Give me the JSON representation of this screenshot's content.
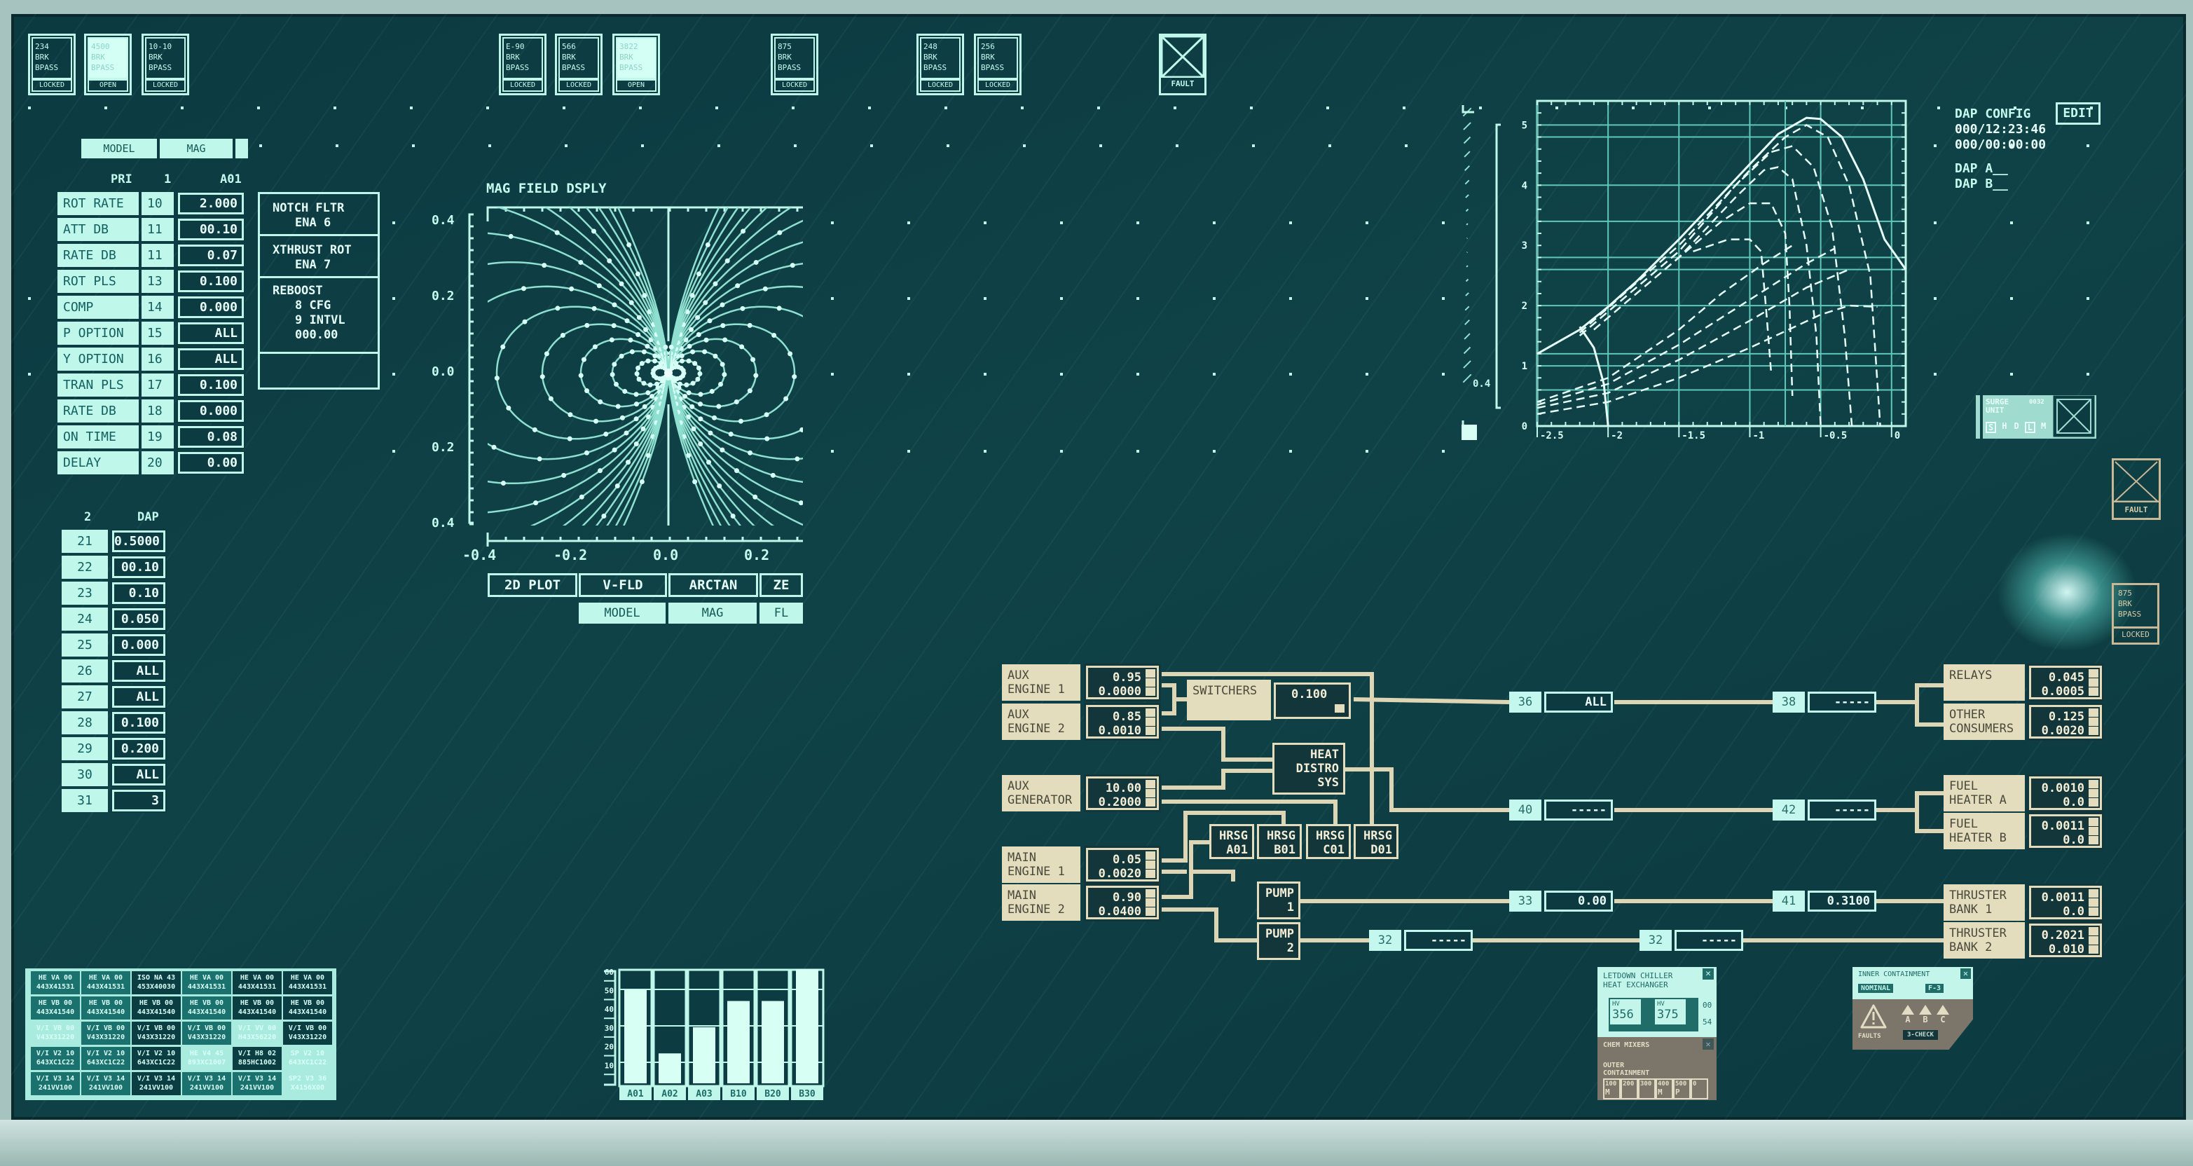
{
  "colors": {
    "screen": "#0c3a41",
    "accent_cyan": "#bff7ea",
    "diagram_tan": "#e3dcbd",
    "frame": "#a7c3bf"
  },
  "top_tiles": [
    {
      "code": "234",
      "l1": "BRK",
      "l2": "BPASS",
      "status": "LOCKED",
      "open": false
    },
    {
      "code": "4500",
      "l1": "BRK",
      "l2": "BPASS",
      "status": "OPEN",
      "open": true
    },
    {
      "code": "10-10",
      "l1": "BRK",
      "l2": "BPASS",
      "status": "LOCKED",
      "open": false
    },
    {
      "code": "E-90",
      "l1": "BRK",
      "l2": "BPASS",
      "status": "LOCKED",
      "open": false
    },
    {
      "code": "566",
      "l1": "BRK",
      "l2": "BPASS",
      "status": "LOCKED",
      "open": false
    },
    {
      "code": "3822",
      "l1": "BRK",
      "l2": "BPASS",
      "status": "OPEN",
      "open": true
    },
    {
      "code": "875",
      "l1": "BRK",
      "l2": "BPASS",
      "status": "LOCKED",
      "open": false
    },
    {
      "code": "248",
      "l1": "BRK",
      "l2": "BPASS",
      "status": "LOCKED",
      "open": false
    },
    {
      "code": "256",
      "l1": "BRK",
      "l2": "BPASS",
      "status": "LOCKED",
      "open": false
    }
  ],
  "top_fault": {
    "label": "FAULT",
    "icon": "x-box-icon"
  },
  "left_tabs": [
    "MODEL",
    "MAG",
    ""
  ],
  "pri_table": {
    "headers": [
      "PRI",
      "1",
      "A01"
    ],
    "rows": [
      {
        "label": "ROT RATE",
        "code": "10",
        "value": "2.000"
      },
      {
        "label": "ATT DB",
        "code": "11",
        "value": "00.10"
      },
      {
        "label": "RATE DB",
        "code": "11",
        "value": "0.07"
      },
      {
        "label": "ROT PLS",
        "code": "13",
        "value": "0.100"
      },
      {
        "label": "COMP",
        "code": "14",
        "value": "0.000"
      },
      {
        "label": "P OPTION",
        "code": "15",
        "value": "ALL"
      },
      {
        "label": "Y OPTION",
        "code": "16",
        "value": "ALL"
      },
      {
        "label": "TRAN PLS",
        "code": "17",
        "value": "0.100"
      },
      {
        "label": "RATE DB",
        "code": "18",
        "value": "0.000"
      },
      {
        "label": "ON TIME",
        "code": "19",
        "value": "0.08"
      },
      {
        "label": "DELAY",
        "code": "20",
        "value": "0.00"
      }
    ]
  },
  "options_panel": {
    "notch": [
      "NOTCH FLTR",
      "ENA 6"
    ],
    "xthrust": [
      "XTHRUST ROT",
      "ENA 7"
    ],
    "reboost": [
      "REBOOST",
      "8 CFG",
      "9 INTVL",
      "000.00"
    ]
  },
  "dap_table": {
    "headers": [
      "2",
      "DAP"
    ],
    "rows": [
      {
        "code": "21",
        "value": "0.5000"
      },
      {
        "code": "22",
        "value": "00.10"
      },
      {
        "code": "23",
        "value": "0.10"
      },
      {
        "code": "24",
        "value": "0.050"
      },
      {
        "code": "25",
        "value": "0.000"
      },
      {
        "code": "26",
        "value": "ALL"
      },
      {
        "code": "27",
        "value": "ALL"
      },
      {
        "code": "28",
        "value": "0.100"
      },
      {
        "code": "29",
        "value": "0.200"
      },
      {
        "code": "30",
        "value": "ALL"
      },
      {
        "code": "31",
        "value": "3"
      }
    ]
  },
  "mag_plot": {
    "title": "MAG FIELD DSPLY",
    "y_ticks": [
      "0.4",
      "0.2",
      "0.0",
      "0.2",
      "0.4"
    ],
    "x_ticks": [
      "-0.4",
      "-0.2",
      "0.0",
      "0.2"
    ],
    "mode_buttons": [
      "2D PLOT",
      "V-FLD",
      "ARCTAN",
      "ZE"
    ],
    "sub_buttons": [
      "MODEL",
      "MAG",
      "FL"
    ]
  },
  "sensor_grid": [
    [
      {
        "a": "HE VA 00",
        "b": "443X41531",
        "s": "m"
      },
      {
        "a": "HE VA 00",
        "b": "443X41531",
        "s": "m"
      },
      {
        "a": "ISO NA 43",
        "b": "453X40030",
        "s": "d"
      },
      {
        "a": "HE VA 00",
        "b": "443X41531",
        "s": "m"
      },
      {
        "a": "HE VA 00",
        "b": "443X41531",
        "s": "d"
      },
      {
        "a": "HE VA 00",
        "b": "443X41531",
        "s": "d"
      }
    ],
    [
      {
        "a": "HE VB 00",
        "b": "443X41540",
        "s": "m"
      },
      {
        "a": "HE VB 00",
        "b": "443X41540",
        "s": "m"
      },
      {
        "a": "HE VB 00",
        "b": "443X41540",
        "s": "d"
      },
      {
        "a": "HE VB 00",
        "b": "443X41540",
        "s": "m"
      },
      {
        "a": "HE VB 00",
        "b": "443X41540",
        "s": "d"
      },
      {
        "a": "HE VB 00",
        "b": "443X41540",
        "s": "d"
      }
    ],
    [
      {
        "a": "V/I VB 00",
        "b": "V43X31220",
        "s": "l"
      },
      {
        "a": "V/I VB 00",
        "b": "V43X31220",
        "s": "m"
      },
      {
        "a": "V/I VB 00",
        "b": "V43X31220",
        "s": "d"
      },
      {
        "a": "V/I VB 00",
        "b": "V43X31220",
        "s": "m"
      },
      {
        "a": "V/I VV 00",
        "b": "H43X56220",
        "s": "l"
      },
      {
        "a": "V/I VB 00",
        "b": "V43X31220",
        "s": "d"
      }
    ],
    [
      {
        "a": "V/I V2 10",
        "b": "643XC1C22",
        "s": "m"
      },
      {
        "a": "V/I V2 10",
        "b": "643XC1C22",
        "s": "m"
      },
      {
        "a": "V/I V2 10",
        "b": "643XC1C22",
        "s": "d"
      },
      {
        "a": "HE V4 45",
        "b": "893XC1007",
        "s": "l"
      },
      {
        "a": "V/I H8 02",
        "b": "885HC1002",
        "s": "d"
      },
      {
        "a": "SP V2 10",
        "b": "643XC1C22",
        "s": "l"
      }
    ],
    [
      {
        "a": "V/I V3 14",
        "b": "241VV100",
        "s": "m"
      },
      {
        "a": "V/I V3 14",
        "b": "241VV100",
        "s": "m"
      },
      {
        "a": "V/I V3 14",
        "b": "241VV100",
        "s": "d"
      },
      {
        "a": "V/I V3 14",
        "b": "241VV100",
        "s": "m"
      },
      {
        "a": "V/I V3 14",
        "b": "241VV100",
        "s": "m"
      },
      {
        "a": "SP2 V3 36",
        "b": "X4156X00",
        "s": "l"
      }
    ]
  ],
  "chart_data": [
    {
      "type": "bar",
      "categories": [
        "A01",
        "A02",
        "A03",
        "B10",
        "B20",
        "B30"
      ],
      "values": [
        50,
        16,
        30,
        44,
        44,
        61
      ],
      "y_ticks": [
        "60",
        "50",
        "40",
        "30",
        "20",
        "10"
      ],
      "ylim": [
        0,
        62
      ]
    },
    {
      "type": "line",
      "x_ticks": [
        "-2.5",
        "-2",
        "-1.5",
        "-1",
        "-0.5",
        "0"
      ],
      "y_ticks": [
        "5",
        "4",
        "3",
        "2",
        "1",
        "0"
      ],
      "xlim": [
        -2.5,
        0.1
      ],
      "ylim": [
        0,
        5.4
      ],
      "grid": true,
      "series": [
        {
          "style": "solid",
          "points": [
            [
              -2.5,
              1.2
            ],
            [
              -2.2,
              1.6
            ],
            [
              -2,
              1.98
            ],
            [
              -1.8,
              2.4
            ],
            [
              -1.5,
              3.1
            ],
            [
              -1.2,
              3.85
            ],
            [
              -1,
              4.35
            ],
            [
              -0.8,
              4.85
            ],
            [
              -0.6,
              5.12
            ],
            [
              -0.5,
              5.1
            ],
            [
              -0.35,
              4.8
            ],
            [
              -0.2,
              4.1
            ],
            [
              -0.05,
              3.1
            ],
            [
              0.1,
              2.6
            ]
          ]
        },
        {
          "style": "solid",
          "points": [
            [
              -2.2,
              1.65
            ],
            [
              -2.1,
              1.3
            ],
            [
              -2.03,
              0.7
            ],
            [
              -2.0,
              0
            ]
          ]
        },
        {
          "style": "dashed",
          "points": [
            [
              -2.2,
              1.55
            ],
            [
              -1.5,
              3.0
            ],
            [
              -1,
              4.25
            ],
            [
              -0.75,
              4.8
            ],
            [
              -0.6,
              5.0
            ],
            [
              -0.45,
              4.8
            ],
            [
              -0.3,
              4.0
            ],
            [
              -0.15,
              2.5
            ],
            [
              -0.08,
              0
            ]
          ]
        },
        {
          "style": "dashed",
          "points": [
            [
              -2.2,
              1.5
            ],
            [
              -1.5,
              2.9
            ],
            [
              -1.1,
              4.0
            ],
            [
              -0.85,
              4.55
            ],
            [
              -0.7,
              4.65
            ],
            [
              -0.55,
              4.3
            ],
            [
              -0.42,
              3.3
            ],
            [
              -0.33,
              1.5
            ],
            [
              -0.28,
              0
            ]
          ]
        },
        {
          "style": "dashed",
          "points": [
            [
              -2.1,
              1.6
            ],
            [
              -1.5,
              2.8
            ],
            [
              -1.1,
              3.8
            ],
            [
              -0.9,
              4.25
            ],
            [
              -0.8,
              4.3
            ],
            [
              -0.7,
              4.1
            ],
            [
              -0.6,
              3.0
            ],
            [
              -0.53,
              1.5
            ],
            [
              -0.5,
              0
            ]
          ]
        },
        {
          "style": "dashed",
          "points": [
            [
              -1.6,
              2.6
            ],
            [
              -1.2,
              3.4
            ],
            [
              -1,
              3.7
            ],
            [
              -0.85,
              3.7
            ],
            [
              -0.75,
              3.2
            ],
            [
              -0.72,
              2.0
            ],
            [
              -0.7,
              0.5
            ]
          ]
        },
        {
          "style": "dashed",
          "points": [
            [
              -1.4,
              2.9
            ],
            [
              -1.15,
              3.1
            ],
            [
              -1.0,
              3.1
            ],
            [
              -0.92,
              2.9
            ],
            [
              -0.88,
              1.8
            ],
            [
              -0.85,
              0.9
            ]
          ]
        },
        {
          "style": "dashed",
          "points": [
            [
              -2.5,
              0.2
            ],
            [
              -2,
              0.4
            ],
            [
              -1.5,
              0.8
            ],
            [
              -1,
              1.3
            ],
            [
              -0.5,
              1.85
            ],
            [
              -0.3,
              2.0
            ],
            [
              -0.1,
              1.98
            ]
          ]
        },
        {
          "style": "dashed",
          "points": [
            [
              -2.5,
              0.3
            ],
            [
              -2,
              0.55
            ],
            [
              -1.5,
              1.1
            ],
            [
              -1,
              1.75
            ],
            [
              -0.6,
              2.3
            ],
            [
              -0.3,
              2.6
            ]
          ]
        },
        {
          "style": "dashed",
          "points": [
            [
              -2.5,
              0.35
            ],
            [
              -2,
              0.7
            ],
            [
              -1.5,
              1.35
            ],
            [
              -1,
              2.1
            ],
            [
              -0.6,
              2.7
            ],
            [
              -0.4,
              2.95
            ]
          ]
        },
        {
          "style": "dashed",
          "points": [
            [
              -2.5,
              0.4
            ],
            [
              -2,
              0.8
            ],
            [
              -1.5,
              1.6
            ],
            [
              -1.2,
              2.2
            ],
            [
              -0.9,
              2.7
            ],
            [
              -0.7,
              3.0
            ]
          ]
        }
      ]
    }
  ],
  "side_scale": {
    "label": "0.4"
  },
  "dap_config": {
    "title": "DAP CONFIG",
    "edit": "EDIT",
    "time1": "000/12:23:46",
    "time2": "000/00:00:00",
    "dap_a": "DAP A__",
    "dap_b": "DAP B__"
  },
  "surge_unit": {
    "l1": "SURGE",
    "l2": "UNIT",
    "code": "0032",
    "letters": [
      "S",
      "H",
      "D",
      "L",
      "M"
    ],
    "selected": [
      "S",
      "L"
    ]
  },
  "right_fault": {
    "label": "FAULT"
  },
  "right_tile": {
    "code": "875",
    "l1": "BRK",
    "l2": "BPASS",
    "status": "LOCKED"
  },
  "power": {
    "sources": [
      {
        "l1": "AUX",
        "l2": "ENGINE 1",
        "v1": "0.95",
        "v2": "0.0000"
      },
      {
        "l1": "AUX",
        "l2": "ENGINE 2",
        "v1": "0.85",
        "v2": "0.0010"
      },
      {
        "l1": "AUX",
        "l2": "GENERATOR",
        "v1": "10.00",
        "v2": "0.2000"
      },
      {
        "l1": "MAIN",
        "l2": "ENGINE 1",
        "v1": "0.05",
        "v2": "0.0020"
      },
      {
        "l1": "MAIN",
        "l2": "ENGINE 2",
        "v1": "0.90",
        "v2": "0.0400"
      }
    ],
    "switchers": {
      "label": "SWITCHERS",
      "value": "0.100"
    },
    "heat": [
      "HEAT",
      "DISTRO",
      "SYS"
    ],
    "hrsg": [
      [
        "HRSG",
        "A01"
      ],
      [
        "HRSG",
        "B01"
      ],
      [
        "HRSG",
        "C01"
      ],
      [
        "HRSG",
        "D01"
      ]
    ],
    "pumps": [
      [
        "PUMP",
        "1"
      ],
      [
        "PUMP",
        "2"
      ]
    ],
    "nodes": [
      {
        "id": "36",
        "value": "ALL"
      },
      {
        "id": "38",
        "value": "-----"
      },
      {
        "id": "40",
        "value": "-----"
      },
      {
        "id": "42",
        "value": "-----"
      },
      {
        "id": "33",
        "value": "0.00"
      },
      {
        "id": "41",
        "value": "0.3100"
      },
      {
        "id": "32",
        "value": "-----"
      },
      {
        "id": "32",
        "value": "-----"
      }
    ],
    "consumers": [
      {
        "l1": "RELAYS",
        "l2": "",
        "v1": "0.045",
        "v2": "0.0005"
      },
      {
        "l1": "OTHER",
        "l2": "CONSUMERS",
        "v1": "0.125",
        "v2": "0.0020"
      },
      {
        "l1": "FUEL",
        "l2": "HEATER A",
        "v1": "0.0010",
        "v2": "0.0"
      },
      {
        "l1": "FUEL",
        "l2": "HEATER B",
        "v1": "0.0011",
        "v2": "0.0"
      },
      {
        "l1": "THRUSTER",
        "l2": "BANK 1",
        "v1": "0.0011",
        "v2": "0.0"
      },
      {
        "l1": "THRUSTER",
        "l2": "BANK 2",
        "v1": "0.2021",
        "v2": "0.010"
      }
    ]
  },
  "letdown": {
    "t1": "LETDOWN CHILLER",
    "t2": "HEAT EXCHANGER",
    "hv_label": "HV",
    "hv1": "356",
    "hv2": "375",
    "side1": "00",
    "side2": "54",
    "chem": "CHEM MIXERS",
    "outer1": "OUTER",
    "outer2": "CONTAINMENT",
    "cells": [
      [
        "100",
        "M"
      ],
      [
        "200",
        ""
      ],
      [
        "300",
        ""
      ],
      [
        "400",
        "M"
      ],
      [
        "500",
        "P"
      ],
      [
        "0",
        ""
      ]
    ]
  },
  "inner": {
    "title": "INNER CONTAINMENT",
    "status": "NOMINAL",
    "code": "F-3",
    "faults": "FAULTS",
    "abc": [
      "A",
      "B",
      "C"
    ],
    "check": "3-CHECK"
  }
}
